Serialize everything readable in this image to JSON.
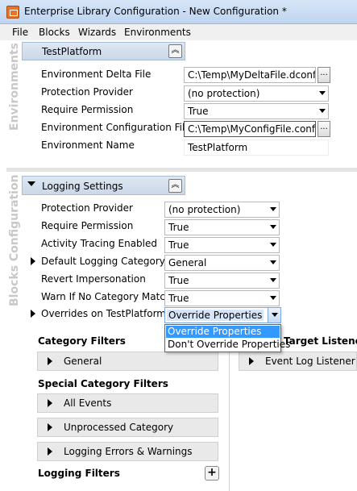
{
  "window": {
    "title": "Enterprise Library Configuration - New Configuration *"
  },
  "menu": [
    "File",
    "Blocks",
    "Wizards",
    "Environments"
  ],
  "sections": {
    "environments_label": "Environments",
    "blocks_label": "Blocks Configuration"
  },
  "environment": {
    "header": "TestPlatform",
    "props": [
      {
        "label": "Environment Delta File",
        "value": "C:\\Temp\\MyDeltaFile.dconfig"
      },
      {
        "label": "Protection Provider",
        "value": "(no protection)"
      },
      {
        "label": "Require Permission",
        "value": "True"
      },
      {
        "label": "Environment Configuration File",
        "value": "C:\\Temp\\MyConfigFile.config"
      },
      {
        "label": "Environment Name",
        "value": "TestPlatform"
      }
    ],
    "ellipsis": "..."
  },
  "logging": {
    "header": "Logging Settings",
    "props": [
      {
        "label": "Protection Provider",
        "value": "(no protection)"
      },
      {
        "label": "Require Permission",
        "value": "True"
      },
      {
        "label": "Activity Tracing Enabled",
        "value": "True"
      },
      {
        "label": "Default Logging Category",
        "value": "General"
      },
      {
        "label": "Revert Impersonation",
        "value": "True"
      },
      {
        "label": "Warn If No Category Match",
        "value": "True"
      },
      {
        "label": "Overrides on TestPlatform",
        "value": "Override Properties"
      }
    ],
    "override_options": [
      "Override Properties",
      "Don't Override Properties"
    ]
  },
  "panels": {
    "category_filters": "Category Filters",
    "general": "General",
    "special_category_filters": "Special Category Filters",
    "all_events": "All Events",
    "unprocessed_category": "Unprocessed Category",
    "logging_errors_warnings": "Logging Errors & Warnings",
    "logging_filters": "Logging Filters",
    "target_listeners": "Target Listeners",
    "event_log_listener": "Event Log Listener",
    "plus": "+"
  },
  "icons": {
    "collapse": "chevron-up-double-icon",
    "expander": "triangle-right-icon",
    "dropdown": "chevron-down-icon"
  }
}
